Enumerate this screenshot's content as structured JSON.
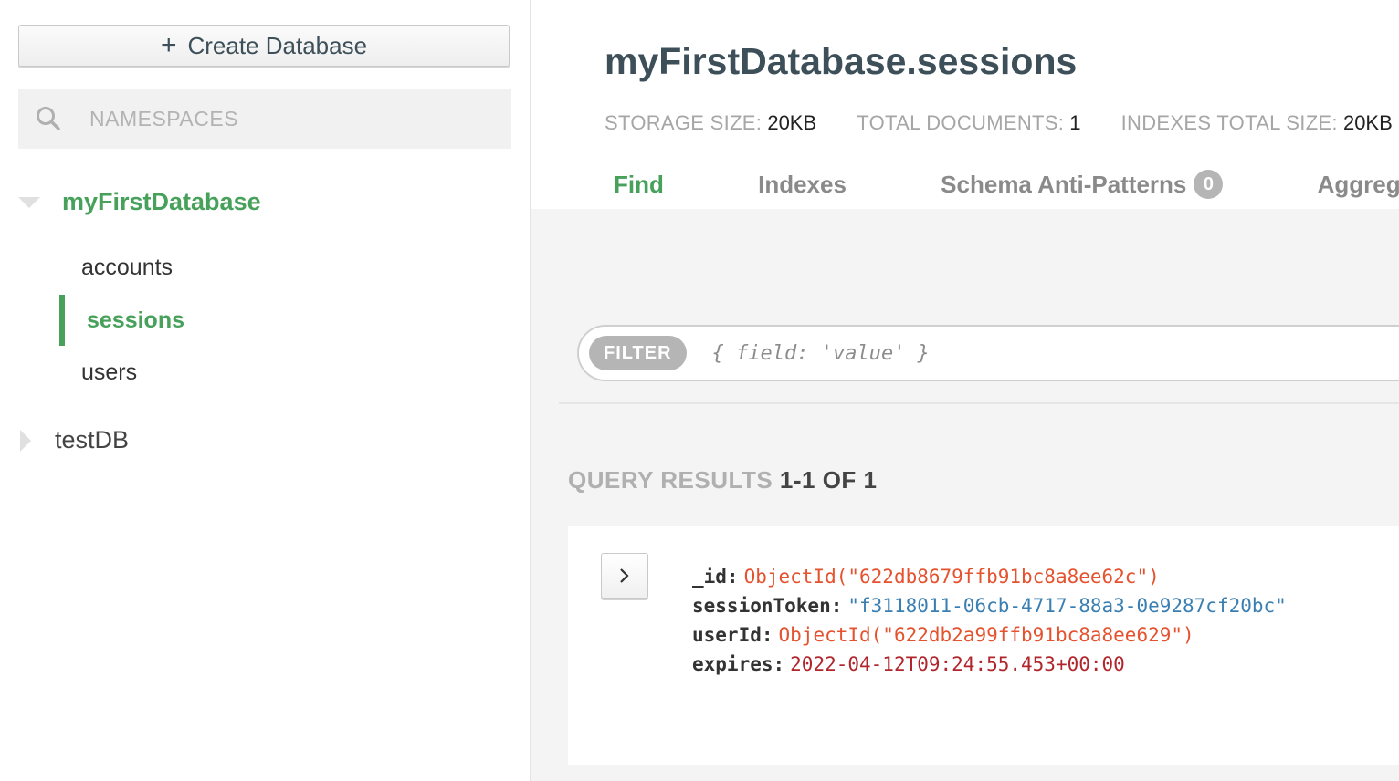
{
  "sidebar": {
    "create_label": "Create Database",
    "create_icon": "plus-icon",
    "search_placeholder": "NAMESPACES",
    "databases": [
      {
        "name": "myFirstDatabase",
        "expanded": true,
        "collections": [
          "accounts",
          "sessions",
          "users"
        ],
        "active_collection": "sessions"
      },
      {
        "name": "testDB",
        "expanded": false
      }
    ]
  },
  "header": {
    "title": "myFirstDatabase.sessions",
    "stats": [
      {
        "label": "STORAGE SIZE:",
        "value": "20KB"
      },
      {
        "label": "TOTAL DOCUMENTS:",
        "value": "1"
      },
      {
        "label": "INDEXES TOTAL SIZE:",
        "value": "20KB"
      }
    ],
    "tabs": [
      {
        "label": "Find",
        "active": true
      },
      {
        "label": "Indexes"
      },
      {
        "label": "Schema Anti-Patterns",
        "badge": "0"
      },
      {
        "label": "Aggregation"
      }
    ]
  },
  "filter": {
    "pill": "FILTER",
    "placeholder": "{ field: 'value' }"
  },
  "results": {
    "label": "QUERY RESULTS",
    "count": "1-1 OF 1"
  },
  "document": {
    "fields": [
      {
        "key": "_id:",
        "value": "ObjectId(\"622db8679ffb91bc8a8ee62c\")",
        "color": "#e5522e"
      },
      {
        "key": "sessionToken:",
        "value": "\"f3118011-06cb-4717-88a3-0e9287cf20bc\"",
        "color": "#3a7fb2"
      },
      {
        "key": "userId:",
        "value": "ObjectId(\"622db2a99ffb91bc8a8ee629\")",
        "color": "#e5522e"
      },
      {
        "key": "expires:",
        "value": "2022-04-12T09:24:55.453+00:00",
        "color": "#b0262c"
      }
    ]
  },
  "colors": {
    "accent": "#47a15a",
    "oid": "#e5522e",
    "string": "#3a7fb2",
    "date": "#b0262c"
  }
}
